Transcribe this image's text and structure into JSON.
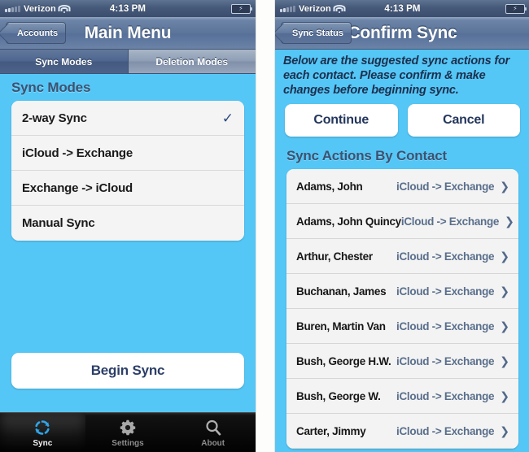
{
  "status_bar": {
    "carrier": "Verizon",
    "time": "4:13 PM",
    "signal_icon": "signal-bars-icon",
    "wifi_icon": "wifi-icon",
    "battery_icon": "battery-charging-icon"
  },
  "colors": {
    "background_blue": "#55c7f7",
    "navbar_blue_gray": "#5b7499",
    "accent_navy": "#2c3e68",
    "action_text": "#5a6f8c"
  },
  "left_phone": {
    "nav": {
      "back_label": "Accounts",
      "title": "Main Menu"
    },
    "segmented": {
      "options": [
        {
          "label": "Sync Modes",
          "selected": true
        },
        {
          "label": "Deletion Modes",
          "selected": false
        }
      ]
    },
    "section_header": "Sync Modes",
    "modes": [
      {
        "label": "2-way Sync",
        "checked": true
      },
      {
        "label": "iCloud -> Exchange",
        "checked": false
      },
      {
        "label": "Exchange -> iCloud",
        "checked": false
      },
      {
        "label": "Manual Sync",
        "checked": false
      }
    ],
    "checkmark_glyph": "✓",
    "begin_button": "Begin Sync",
    "tabs": [
      {
        "label": "Sync",
        "icon": "sync-arrows-icon",
        "selected": true
      },
      {
        "label": "Settings",
        "icon": "gear-icon",
        "selected": false
      },
      {
        "label": "About",
        "icon": "magnifier-icon",
        "selected": false
      }
    ]
  },
  "right_phone": {
    "nav": {
      "back_label": "Sync Status",
      "title": "Confirm Sync"
    },
    "intro": "Below are the suggested sync actions for each contact.  Please confirm & make changes before beginning sync.",
    "buttons": {
      "continue": "Continue",
      "cancel": "Cancel"
    },
    "section_header": "Sync Actions By Contact",
    "chevron_glyph": "❯",
    "contacts": [
      {
        "name": "Adams, John",
        "action": "iCloud -> Exchange"
      },
      {
        "name": "Adams, John Quincy",
        "action": "iCloud -> Exchange"
      },
      {
        "name": "Arthur, Chester",
        "action": "iCloud -> Exchange"
      },
      {
        "name": "Buchanan, James",
        "action": "iCloud -> Exchange"
      },
      {
        "name": "Buren, Martin Van",
        "action": "iCloud -> Exchange"
      },
      {
        "name": "Bush, George H.W.",
        "action": "iCloud -> Exchange"
      },
      {
        "name": "Bush, George W.",
        "action": "iCloud -> Exchange"
      },
      {
        "name": "Carter, Jimmy",
        "action": "iCloud -> Exchange"
      }
    ]
  }
}
